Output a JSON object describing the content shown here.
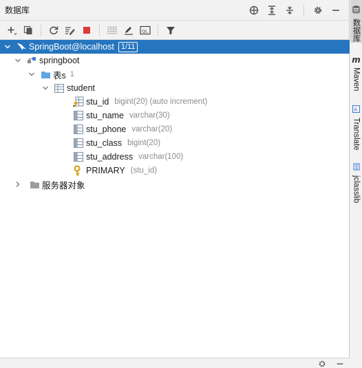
{
  "panel": {
    "title": "数据库"
  },
  "title_actions": [
    {
      "name": "add-target-icon"
    },
    {
      "name": "expand-all-icon"
    },
    {
      "name": "collapse-all-icon"
    },
    {
      "name": "gear-icon"
    },
    {
      "name": "minimize-icon"
    }
  ],
  "toolbar": {
    "items": [
      "add-icon",
      "duplicate-icon",
      "refresh-icon",
      "schema-properties-icon",
      "stop-icon",
      "table-editor-icon",
      "edit-icon",
      "query-console-icon",
      "filter-icon"
    ]
  },
  "tree": {
    "datasource": {
      "label": "SpringBoot@localhost",
      "badge": "1/11"
    },
    "schema": {
      "label": "springboot"
    },
    "tables_folder": {
      "label": "表s",
      "count": "1"
    },
    "table": {
      "label": "student"
    },
    "columns": [
      {
        "name": "stu_id",
        "type": "bigint(20) (auto increment)",
        "icon": "primary-key-column-icon"
      },
      {
        "name": "stu_name",
        "type": "varchar(30)",
        "icon": "column-icon"
      },
      {
        "name": "stu_phone",
        "type": "varchar(20)",
        "icon": "column-icon"
      },
      {
        "name": "stu_class",
        "type": "bigint(20)",
        "icon": "column-icon"
      },
      {
        "name": "stu_address",
        "type": "varchar(100)",
        "icon": "column-icon"
      }
    ],
    "key": {
      "name": "PRIMARY",
      "cols": "(stu_id)"
    },
    "server_objects": {
      "label": "服务器对象"
    }
  },
  "stripe": {
    "database": "数据库",
    "maven": "Maven",
    "translate": "Translate",
    "jclasslib": "jclasslib"
  },
  "colors": {
    "selection": "#2675bf",
    "accent_blue": "#3d7bd9",
    "stop_red": "#db3b3b",
    "key_gold": "#d9a21b"
  }
}
